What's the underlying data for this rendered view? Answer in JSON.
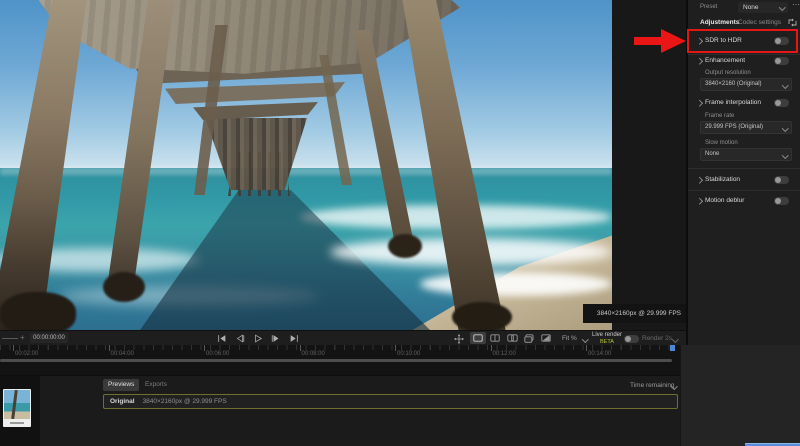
{
  "colors": {
    "accent_red": "#e41616",
    "progress_blue": "#5b8dd9",
    "beta_yellow": "#b9c433",
    "row_olive": "#6f6e2e"
  },
  "viewport": {
    "resolution_overlay": "3840×2160px @ 29.999 FPS"
  },
  "sidebar": {
    "preset_label": "Preset",
    "preset_value": "None",
    "tabs": {
      "adjustments": "Adjustments",
      "codec_settings": "Codec settings"
    },
    "sdr_to_hdr": {
      "label": "SDR to HDR",
      "enabled": false
    },
    "enhancement": {
      "label": "Enhancement",
      "enabled": false
    },
    "output_resolution": {
      "label": "Output resolution",
      "value": "3840×2160 (Original)"
    },
    "frame_interpolation": {
      "label": "Frame interpolation",
      "enabled": false
    },
    "frame_rate": {
      "label": "Frame rate",
      "value": "29.999 FPS (Original)"
    },
    "slow_motion": {
      "label": "Slow motion",
      "value": "None"
    },
    "stabilization": {
      "label": "Stabilization",
      "enabled": false
    },
    "motion_deblur": {
      "label": "Motion deblur",
      "enabled": false
    }
  },
  "transport": {
    "timecode": "00:00:00:00",
    "zoom_plus": "+",
    "fit_label": "Fit %",
    "live_render_label": "Live render",
    "beta_label": "BETA",
    "render_label": "Render 2s"
  },
  "timeline": {
    "ticks": [
      "00:02:00",
      "00:04:00",
      "00:06:00",
      "00:08:00",
      "00:10:00",
      "00:12:00",
      "00:14:00"
    ]
  },
  "bottom_panel": {
    "tabs": {
      "previews": "Previews",
      "exports": "Exports"
    },
    "time_remaining": "Time remaining",
    "preview_row": {
      "name": "Original",
      "info": "3840×2160px @ 29.999 FPS"
    }
  }
}
